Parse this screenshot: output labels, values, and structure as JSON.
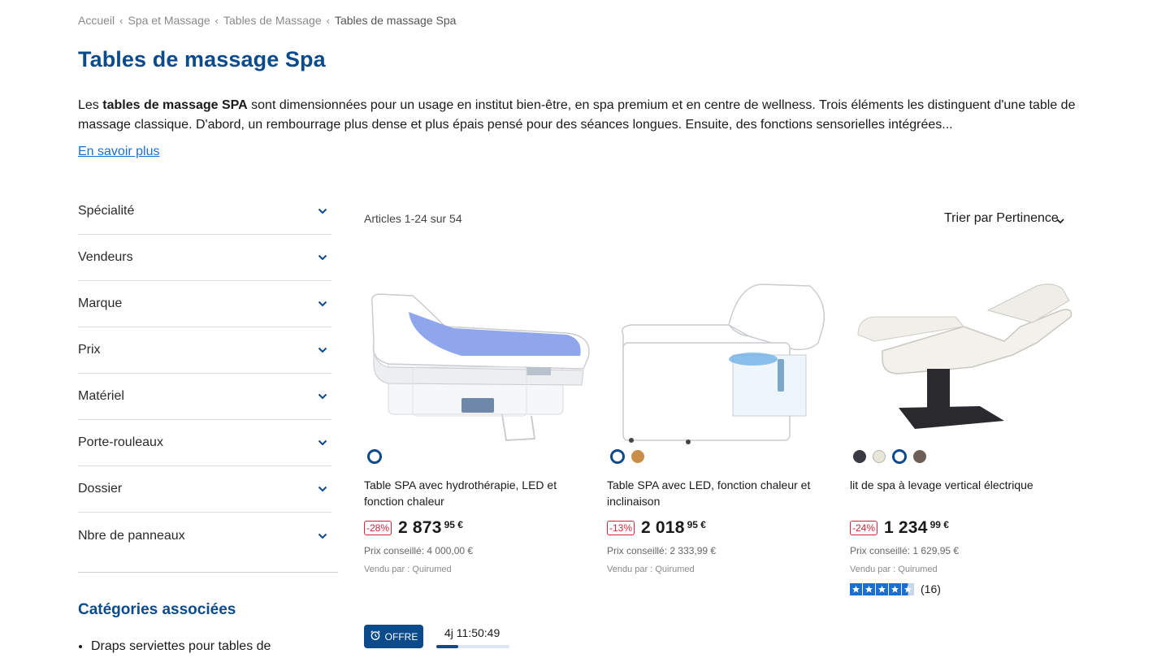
{
  "breadcrumb": [
    {
      "label": "Accueil"
    },
    {
      "label": "Spa et Massage"
    },
    {
      "label": "Tables de Massage"
    },
    {
      "label": "Tables de massage Spa"
    }
  ],
  "breadcrumb_separator": "‹",
  "page_title": "Tables de massage Spa",
  "intro": {
    "lead": "Les ",
    "bold": "tables de massage SPA",
    "rest": " sont dimensionnées pour un usage en institut bien-être, en spa premium et en centre de wellness. Trois éléments les distinguent d'une table de massage classique. D'abord, un rembourrage plus dense et plus épais pensé pour des séances longues. Ensuite, des fonctions sensorielles intégrées..."
  },
  "more_link": "En savoir plus",
  "filters": [
    {
      "label": "Spécialité"
    },
    {
      "label": "Vendeurs"
    },
    {
      "label": "Marque"
    },
    {
      "label": "Prix"
    },
    {
      "label": "Matériel"
    },
    {
      "label": "Porte-rouleaux"
    },
    {
      "label": "Dossier"
    },
    {
      "label": "Nbre de panneaux"
    }
  ],
  "related": {
    "title": "Catégories associées",
    "items": [
      "Draps serviettes pour tables de"
    ]
  },
  "listing": {
    "count_text": "Articles 1-24 sur 54",
    "sort_label": "Trier par Pertinence"
  },
  "products": [
    {
      "name": "Table SPA avec hydrothérapie, LED et fonction chaleur",
      "discount": "-28%",
      "price_main": "2 873",
      "price_cents": "95 €",
      "rrp": "Prix conseillé:  4 000,00 €",
      "seller": "Vendu par : Quirumed",
      "swatches": [
        {
          "color": "#ffffff",
          "selected": true
        }
      ]
    },
    {
      "name": "Table SPA avec LED, fonction chaleur et inclinaison",
      "discount": "-13%",
      "price_main": "2 018",
      "price_cents": "95 €",
      "rrp": "Prix conseillé:  2 333,99 €",
      "seller": "Vendu par : Quirumed",
      "swatches": [
        {
          "color": "#ffffff",
          "selected": true
        },
        {
          "color": "#c98f4a",
          "selected": false
        }
      ]
    },
    {
      "name": "lit de spa à levage vertical électrique",
      "discount": "-24%",
      "price_main": "1 234",
      "price_cents": "99 €",
      "rrp": "Prix conseillé:  1 629,95 €",
      "seller": "Vendu par : Quirumed",
      "swatches": [
        {
          "color": "#3a3a44",
          "selected": false
        },
        {
          "color": "#e8e6d8",
          "selected": false
        },
        {
          "color": "#ffffff",
          "selected": true
        },
        {
          "color": "#6e5e58",
          "selected": false
        }
      ],
      "rating_value": 4.5,
      "rating_count": "(16)"
    }
  ],
  "offer": {
    "badge": "OFFRE",
    "countdown": "4j 11:50:49",
    "progress": 0.3
  },
  "colors": {
    "brand": "#0b4a8b",
    "link": "#1a6fd1",
    "discount": "#d6233a"
  }
}
